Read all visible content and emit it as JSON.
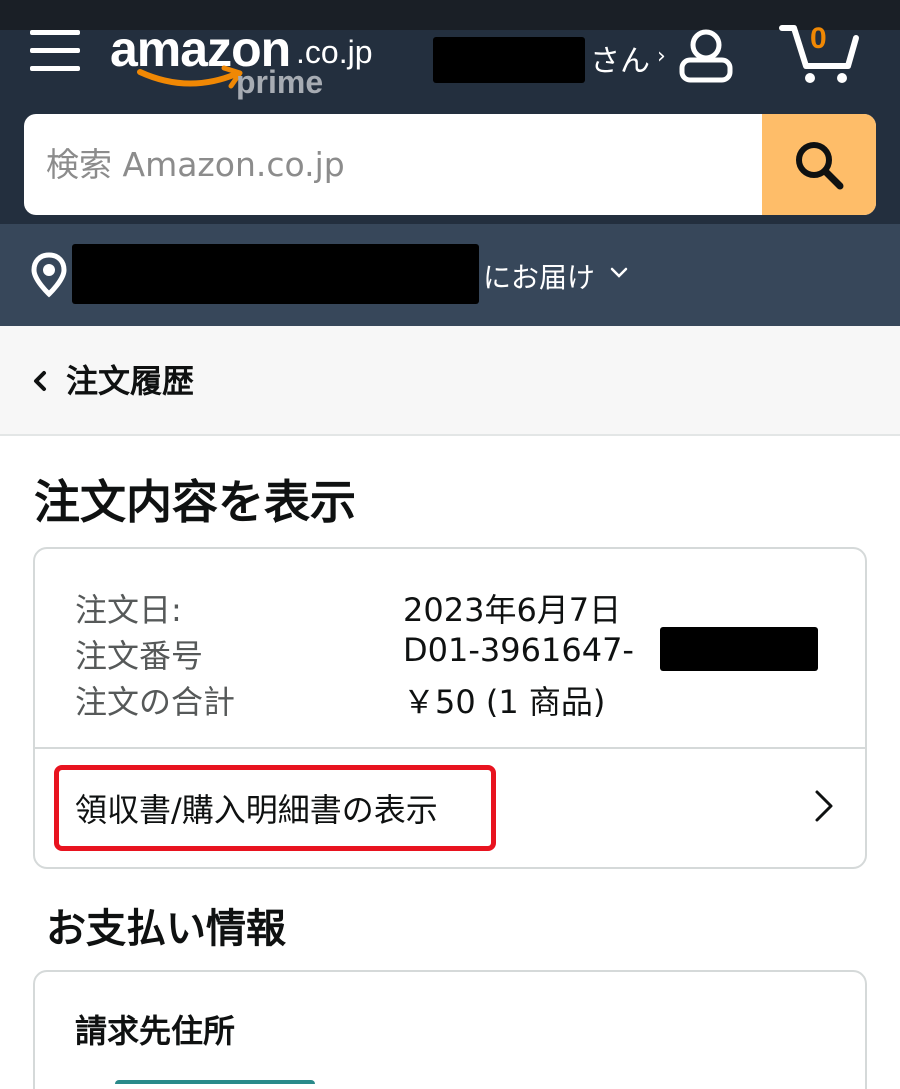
{
  "header": {
    "logo": {
      "word": "amazon",
      "tld": ".co.jp",
      "sub": "prime"
    },
    "greeting_suffix": "さん",
    "greeting_chevron": "›",
    "cart_count": "0",
    "colors": {
      "bar": "#232f3e",
      "accent": "#febd69",
      "cart": "#f08804"
    }
  },
  "search": {
    "placeholder": "検索 Amazon.co.jp"
  },
  "delivery": {
    "label": "にお届け"
  },
  "breadcrumb": {
    "label": "注文履歴"
  },
  "page_title": "注文内容を表示",
  "order": {
    "rows": [
      {
        "label": "注文日:",
        "value": "2023年6月7日"
      },
      {
        "label": "注文番号",
        "value": "D01-3961647-"
      },
      {
        "label": "注文の合計",
        "value": "￥50 (1 商品)"
      }
    ],
    "invoice_link": "領収書/購入明細書の表示",
    "highlight_color": "#e8131f"
  },
  "payment": {
    "section_title": "お支払い情報",
    "billing_label": "請求先住所"
  }
}
